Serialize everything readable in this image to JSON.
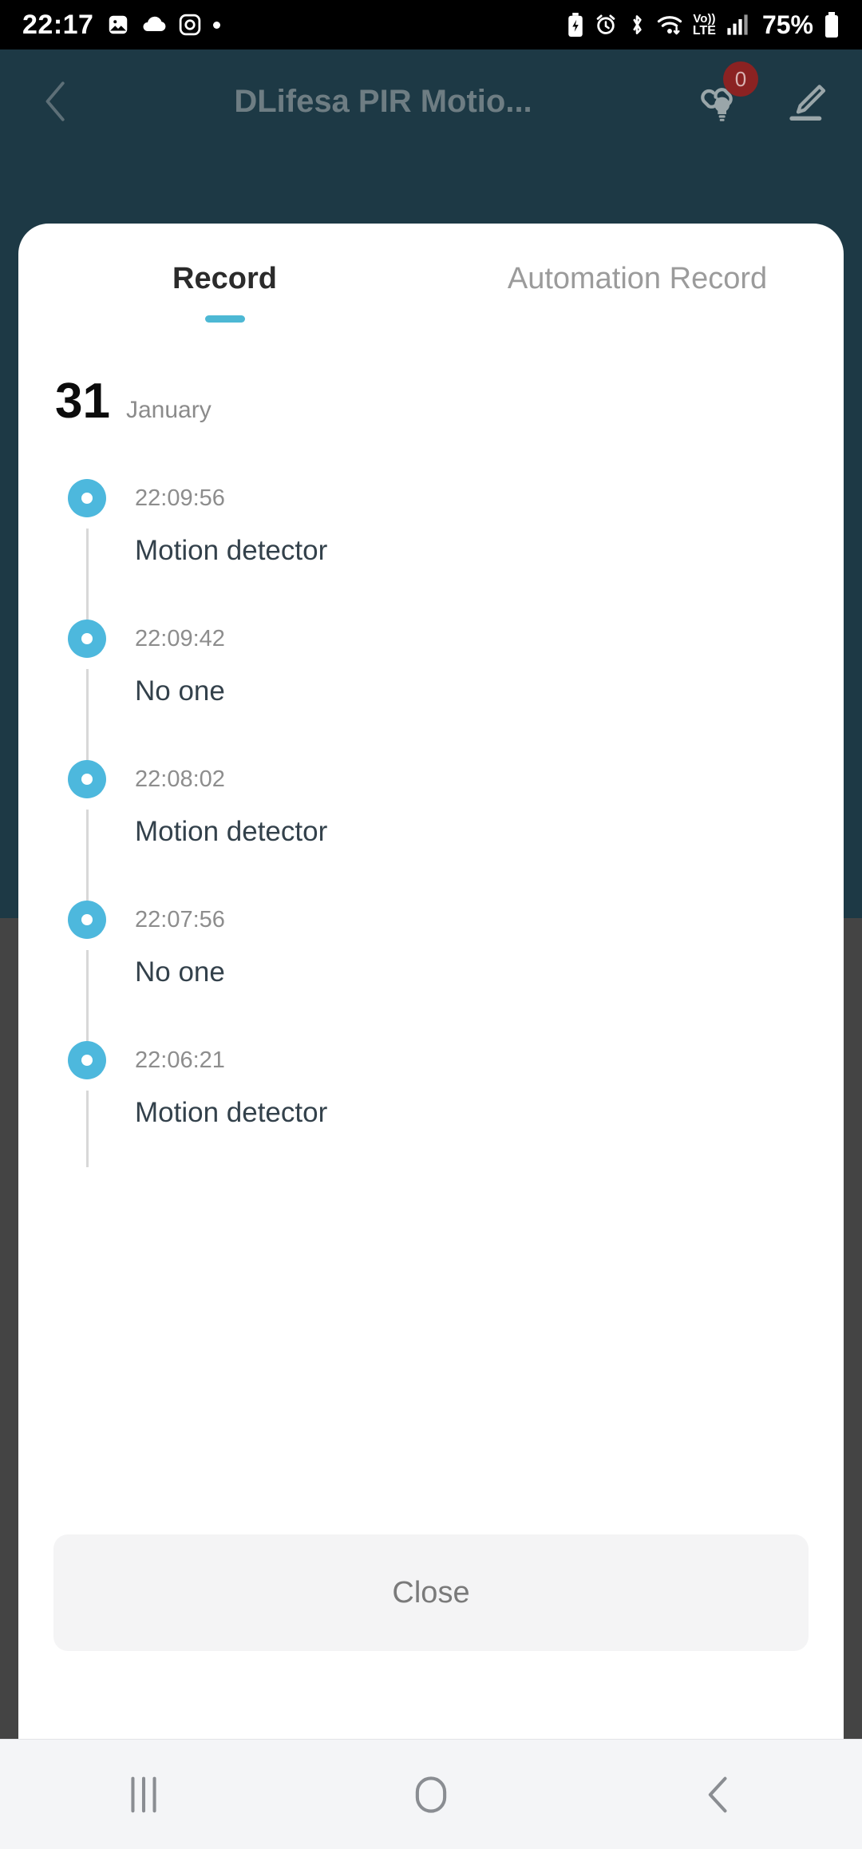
{
  "status_bar": {
    "time": "22:17",
    "battery_percent": "75%",
    "left_icons": [
      "gallery-icon",
      "cloud-icon",
      "instagram-icon",
      "dot-icon"
    ],
    "right_icons": [
      "battery-saver-icon",
      "alarm-icon",
      "bluetooth-icon",
      "wifi-icon",
      "volte-icon",
      "signal-icon",
      "battery-icon"
    ],
    "volte_label_top": "Vo))",
    "volte_label_bottom": "LTE"
  },
  "app_header": {
    "title": "DLifesa PIR Motio...",
    "back_icon": "chevron-left-icon",
    "link_bulb_icon": "link-bulb-icon",
    "link_badge_count": "0",
    "edit_icon": "pencil-edit-icon"
  },
  "sheet": {
    "tabs": [
      {
        "label": "Record",
        "active": true
      },
      {
        "label": "Automation Record",
        "active": false
      }
    ],
    "date": {
      "day": "31",
      "month": "January"
    },
    "records": [
      {
        "time": "22:09:56",
        "label": "Motion detector"
      },
      {
        "time": "22:09:42",
        "label": "No one"
      },
      {
        "time": "22:08:02",
        "label": "Motion detector"
      },
      {
        "time": "22:07:56",
        "label": "No one"
      },
      {
        "time": "22:06:21",
        "label": "Motion detector"
      }
    ],
    "close_label": "Close"
  },
  "nav_bar": {
    "recents_icon": "recents-icon",
    "home_icon": "home-icon",
    "back_icon": "back-icon"
  },
  "colors": {
    "accent_cyan": "#4db8d4",
    "header_bg": "#1d3945",
    "badge_red": "#8b2222",
    "dim_gray": "#444444"
  }
}
